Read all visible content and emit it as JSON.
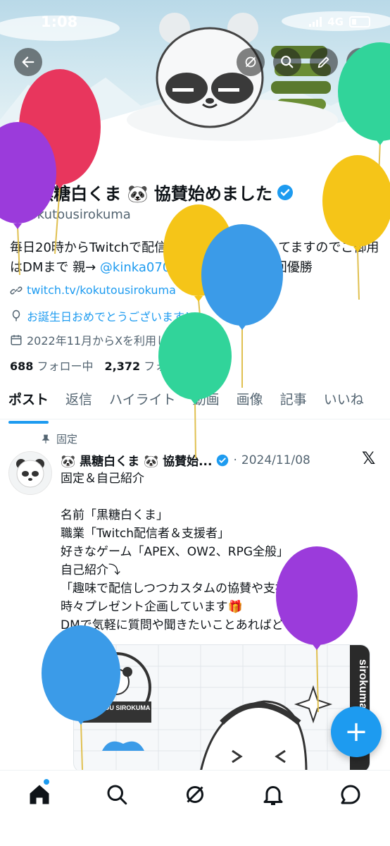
{
  "status_bar": {
    "time": "1:08",
    "network": "4G"
  },
  "header": {
    "back_icon": "arrow-left-icon",
    "actions": [
      "grok-icon",
      "search-icon",
      "edit-icon",
      "more-icon"
    ]
  },
  "profile": {
    "display_name": "🐼 黒糖白くま 🐼 協賛始めました",
    "handle": "@kokutousirokuma",
    "bio_text": "毎日20時からTwitchで配信してます。協賛もしてますのでご御用はDMまで 親→ ",
    "bio_mention": "@kinka0702",
    "bio_tail": " APEXカスタム7回優勝",
    "link": "twitch.tv/kokutousirokuma",
    "birthday": "お誕生日おめでとうございます！",
    "joined": "2022年11月からXを利用しています",
    "following_count": "688",
    "following_label": "フォロー中",
    "followers_count": "2,372",
    "followers_label": "フォロワー"
  },
  "tabs": [
    {
      "label": "ポスト",
      "active": true
    },
    {
      "label": "返信",
      "active": false
    },
    {
      "label": "ハイライト",
      "active": false
    },
    {
      "label": "動画",
      "active": false
    },
    {
      "label": "画像",
      "active": false
    },
    {
      "label": "記事",
      "active": false
    },
    {
      "label": "いいね",
      "active": false
    }
  ],
  "post": {
    "pinned_label": "固定",
    "author": "🐼 黒糖白くま 🐼 協賛始...",
    "separator": "·",
    "date": "2024/11/08",
    "body": "固定＆自己紹介\n\n名前「黒糖白くま」\n職業「Twitch配信者＆支援者」\n好きなゲーム「APEX、OW2、RPG全般」\n自己紹介⤵\n「趣味で配信しつつカスタムの協賛や支援活動、\n時々プレゼント企画しています🎁\nDMで気軽に質問や聞きたいことあればどうぞ😊」",
    "media_text": "KOKUTOU SIROKUMA",
    "media_side_text": "sirokuma"
  },
  "fab_label": "+",
  "bottom_nav": [
    "home-icon",
    "search-icon",
    "grok-icon",
    "notifications-icon",
    "messages-icon"
  ],
  "colors": {
    "accent": "#1d9bf0",
    "text": "#0f1419",
    "muted": "#536471"
  },
  "balloons": [
    {
      "color": "#e8365d",
      "name": "red"
    },
    {
      "color": "#9b3bdb",
      "name": "purple"
    },
    {
      "color": "#f5c518",
      "name": "yellow"
    },
    {
      "color": "#3b9be8",
      "name": "blue"
    },
    {
      "color": "#31d49a",
      "name": "green"
    }
  ]
}
